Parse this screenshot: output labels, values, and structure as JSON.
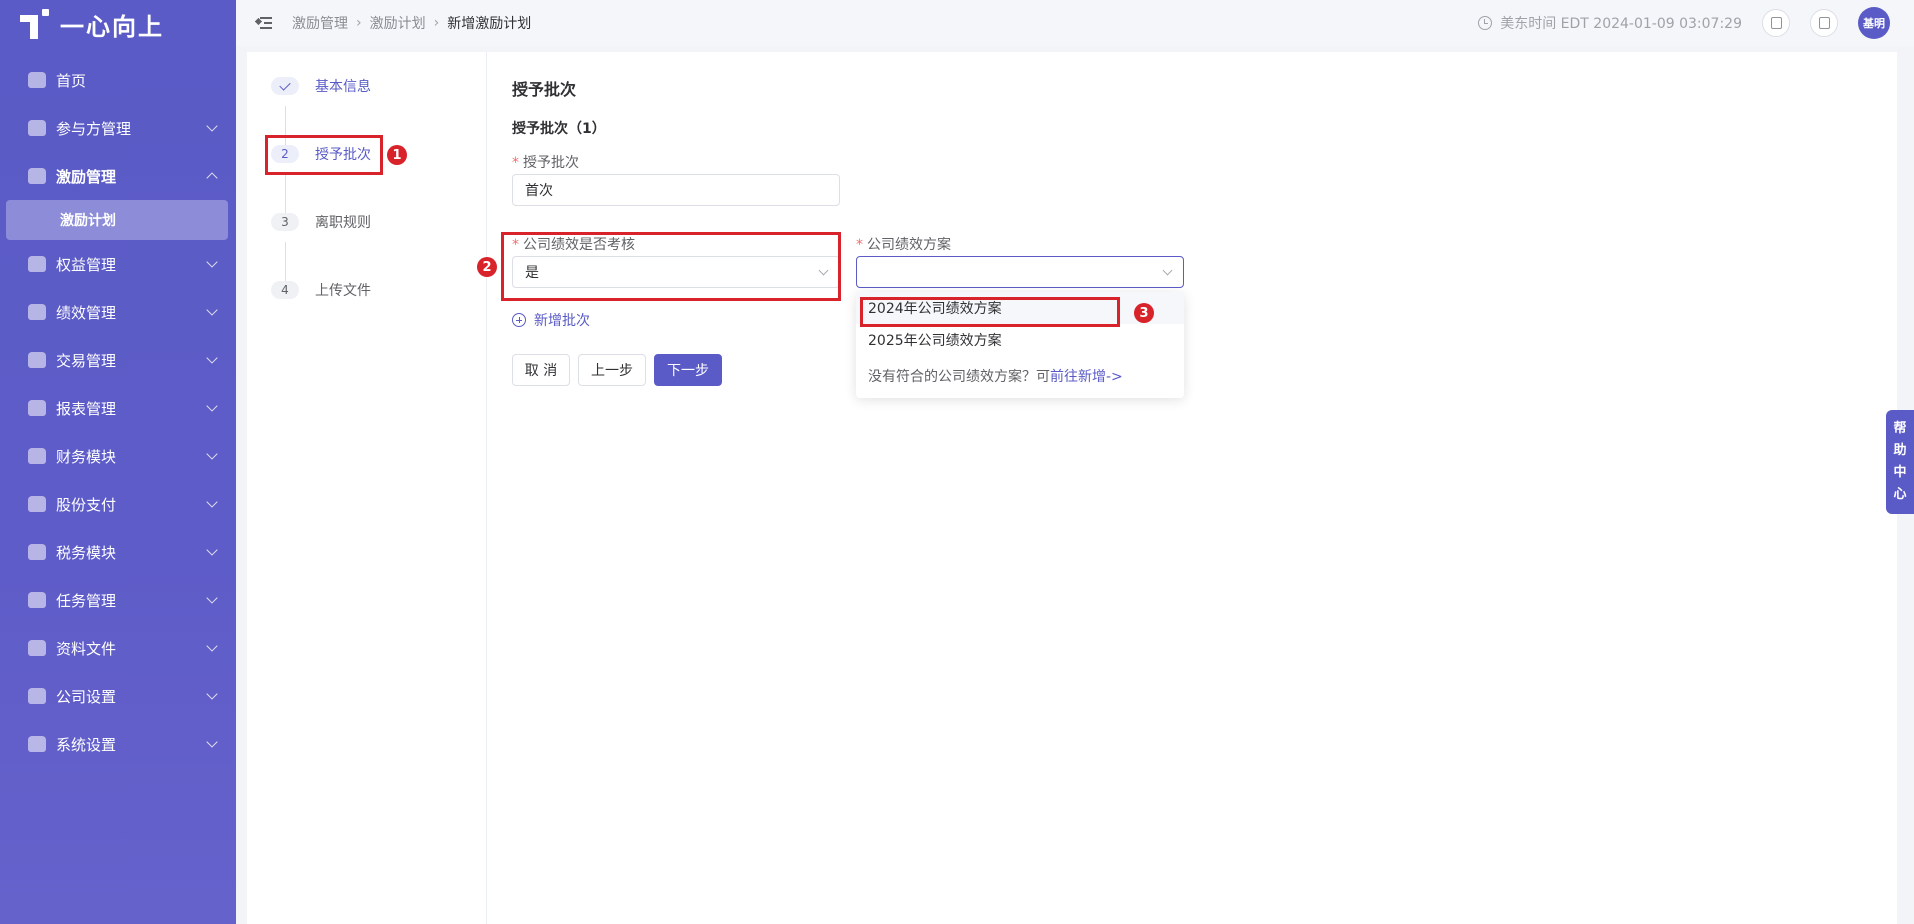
{
  "app": {
    "logo_text": "一心向上"
  },
  "sidebar": {
    "items": [
      {
        "label": "首页",
        "icon": "home-icon",
        "expandable": false
      },
      {
        "label": "参与方管理",
        "icon": "participants-icon",
        "expandable": true
      },
      {
        "label": "激励管理",
        "icon": "incentive-icon",
        "expandable": true,
        "expanded": true
      },
      {
        "label": "权益管理",
        "icon": "equity-icon",
        "expandable": true
      },
      {
        "label": "绩效管理",
        "icon": "performance-icon",
        "expandable": true
      },
      {
        "label": "交易管理",
        "icon": "trade-icon",
        "expandable": true
      },
      {
        "label": "报表管理",
        "icon": "report-icon",
        "expandable": true
      },
      {
        "label": "财务模块",
        "icon": "finance-icon",
        "expandable": true
      },
      {
        "label": "股份支付",
        "icon": "share-payment-icon",
        "expandable": true
      },
      {
        "label": "税务模块",
        "icon": "tax-icon",
        "expandable": true
      },
      {
        "label": "任务管理",
        "icon": "task-icon",
        "expandable": true
      },
      {
        "label": "资料文件",
        "icon": "files-icon",
        "expandable": true
      },
      {
        "label": "公司设置",
        "icon": "company-settings-icon",
        "expandable": true
      },
      {
        "label": "系统设置",
        "icon": "system-settings-icon",
        "expandable": true
      }
    ],
    "sub_item": "激励计划"
  },
  "header": {
    "breadcrumb": [
      "激励管理",
      "激励计划",
      "新增激励计划"
    ],
    "time": "美东时间 EDT 2024-01-09 03:07:29",
    "avatar": "基明"
  },
  "steps": [
    {
      "num": "",
      "label": "基本信息",
      "state": "done"
    },
    {
      "num": "2",
      "label": "授予批次",
      "state": "current"
    },
    {
      "num": "3",
      "label": "离职规则",
      "state": "pending"
    },
    {
      "num": "4",
      "label": "上传文件",
      "state": "pending"
    }
  ],
  "form": {
    "title": "授予批次",
    "batch_title": "授予批次（1）",
    "batch_label": "授予批次",
    "batch_value": "首次",
    "assess_label": "公司绩效是否考核",
    "assess_value": "是",
    "plan_label": "公司绩效方案",
    "plan_value": "",
    "add_batch": "新增批次",
    "buttons": {
      "cancel": "取 消",
      "prev": "上一步",
      "next": "下一步"
    }
  },
  "dropdown": {
    "options": [
      "2024年公司绩效方案",
      "2025年公司绩效方案"
    ],
    "footer_text": "没有符合的公司绩效方案？可",
    "footer_link": "前往新增->"
  },
  "annotations": [
    "1",
    "2",
    "3"
  ],
  "help_tab": [
    "帮",
    "助",
    "中",
    "心"
  ],
  "colors": {
    "accent": "#5a5bc6",
    "annotation": "#d8232a"
  }
}
